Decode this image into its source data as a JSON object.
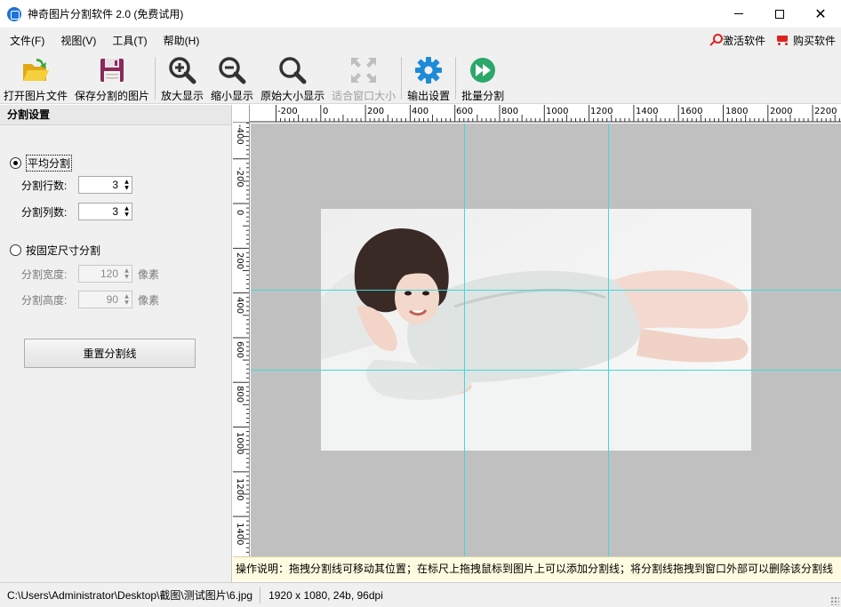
{
  "window": {
    "title": "神奇图片分割软件 2.0 (免费试用)"
  },
  "menu": {
    "items": [
      "文件(F)",
      "视图(V)",
      "工具(T)",
      "帮助(H)"
    ],
    "activate_label": "激活软件",
    "buy_label": "购买软件"
  },
  "toolbar": {
    "open_label": "打开图片文件",
    "save_label": "保存分割的图片",
    "zoom_in_label": "放大显示",
    "zoom_out_label": "缩小显示",
    "actual_size_label": "原始大小显示",
    "fit_window_label": "适合窗口大小",
    "output_settings_label": "输出设置",
    "batch_label": "批量分割"
  },
  "panel": {
    "header": "分割设置",
    "even_split": {
      "label": "平均分割",
      "checked": true,
      "rows_label": "分割行数:",
      "rows_value": "3",
      "cols_label": "分割列数:",
      "cols_value": "3"
    },
    "fixed_split": {
      "label": "按固定尺寸分割",
      "checked": false,
      "width_label": "分割宽度:",
      "width_value": "120",
      "height_label": "分割高度:",
      "height_value": "90",
      "unit": "像素"
    },
    "reset_label": "重置分割线"
  },
  "ruler": {
    "top_labels": [
      "-200",
      "0",
      "200",
      "400",
      "600",
      "800",
      "1000",
      "1200",
      "1400",
      "1600",
      "1800",
      "2000",
      "2200"
    ],
    "left_labels": [
      "-400",
      "-200",
      "0",
      "200",
      "400",
      "600",
      "800",
      "1000",
      "1200",
      "1400"
    ]
  },
  "hint": "操作说明：拖拽分割线可移动其位置；在标尺上拖拽鼠标到图片上可以添加分割线；将分割线拖拽到窗口外部可以删除该分割线",
  "status": {
    "path": "C:\\Users\\Administrator\\Desktop\\截图\\测试图片\\6.jpg",
    "info": "1920 x 1080, 24b, 96dpi"
  },
  "colors": {
    "grid_line": "#3fd8e0",
    "canvas_bg": "#c0c0c0",
    "accent_blue": "#1e8ad8",
    "folder_yellow": "#f2c230",
    "disk_purple": "#8a2a5a"
  },
  "icons": {
    "open": "folder-open-icon",
    "save": "floppy-disk-icon",
    "zoom_in": "zoom-in-icon",
    "zoom_out": "zoom-out-icon",
    "actual_size": "magnifier-icon",
    "fit_window": "fit-window-icon",
    "output_settings": "gear-icon",
    "batch": "fast-forward-icon",
    "activate": "key-icon",
    "buy": "cart-icon"
  }
}
